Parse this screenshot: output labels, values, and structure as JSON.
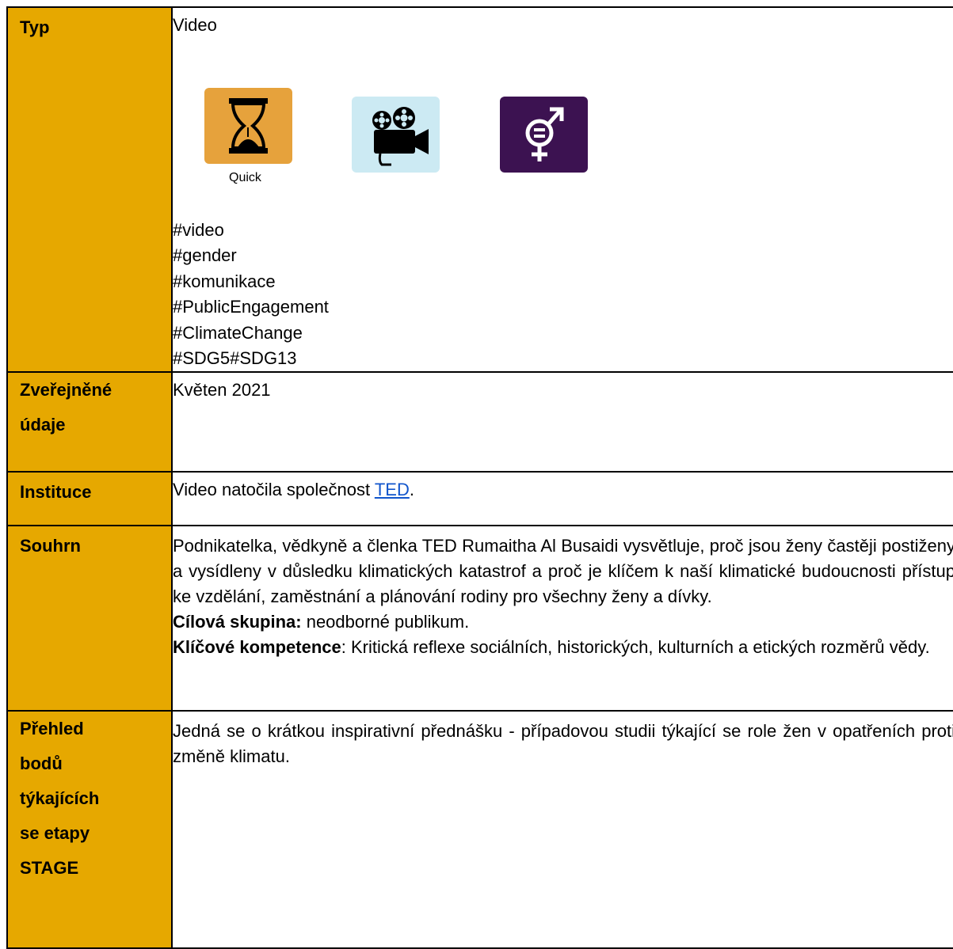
{
  "rows": {
    "typ": {
      "label": "Typ",
      "value": "Video",
      "icons": [
        "hourglass-icon",
        "film-camera-icon",
        "gender-equality-icon"
      ],
      "quick_label": "Quick",
      "tags": [
        "#video",
        "#gender",
        "#komunikace",
        "#PublicEngagement",
        "#ClimateChange",
        "#SDG5#SDG13"
      ]
    },
    "published": {
      "label_lines": [
        "Zveřejněné",
        "údaje"
      ],
      "value": "Květen 2021"
    },
    "institution": {
      "label": "Instituce",
      "text_before": "Video natočila společnost ",
      "link_text": "TED",
      "text_after": "."
    },
    "summary": {
      "label": "Souhrn",
      "paragraph": "Podnikatelka, vědkyně a členka TED Rumaitha Al Busaidi vysvětluje, proč jsou ženy častěji postiženy a vysídleny v důsledku klimatických katastrof a proč je klíčem k naší klimatické budoucnosti přístup ke vzdělání, zaměstnání a plánování rodiny pro všechny ženy a dívky.",
      "audience_label": "Cílová skupina:",
      "audience_value": " neodborné publikum.",
      "competences_label": "Klíčové kompetence",
      "competences_value": ": Kritická reflexe sociálních, historických, kulturních a etických rozměrů vědy."
    },
    "overview": {
      "label_lines": [
        "Přehled",
        "bodů",
        "týkajících",
        "se etapy",
        "STAGE"
      ],
      "value": "Jedná se o krátkou inspirativní přednášku - případovou studii týkající se role žen v opatřeních proti změně klimatu."
    }
  },
  "colors": {
    "label_bg": "#e6a800",
    "quick_icon_bg": "#e6a23c",
    "video_icon_bg": "#cceaf3",
    "gender_icon_bg": "#3c1251",
    "link": "#1155cc"
  }
}
